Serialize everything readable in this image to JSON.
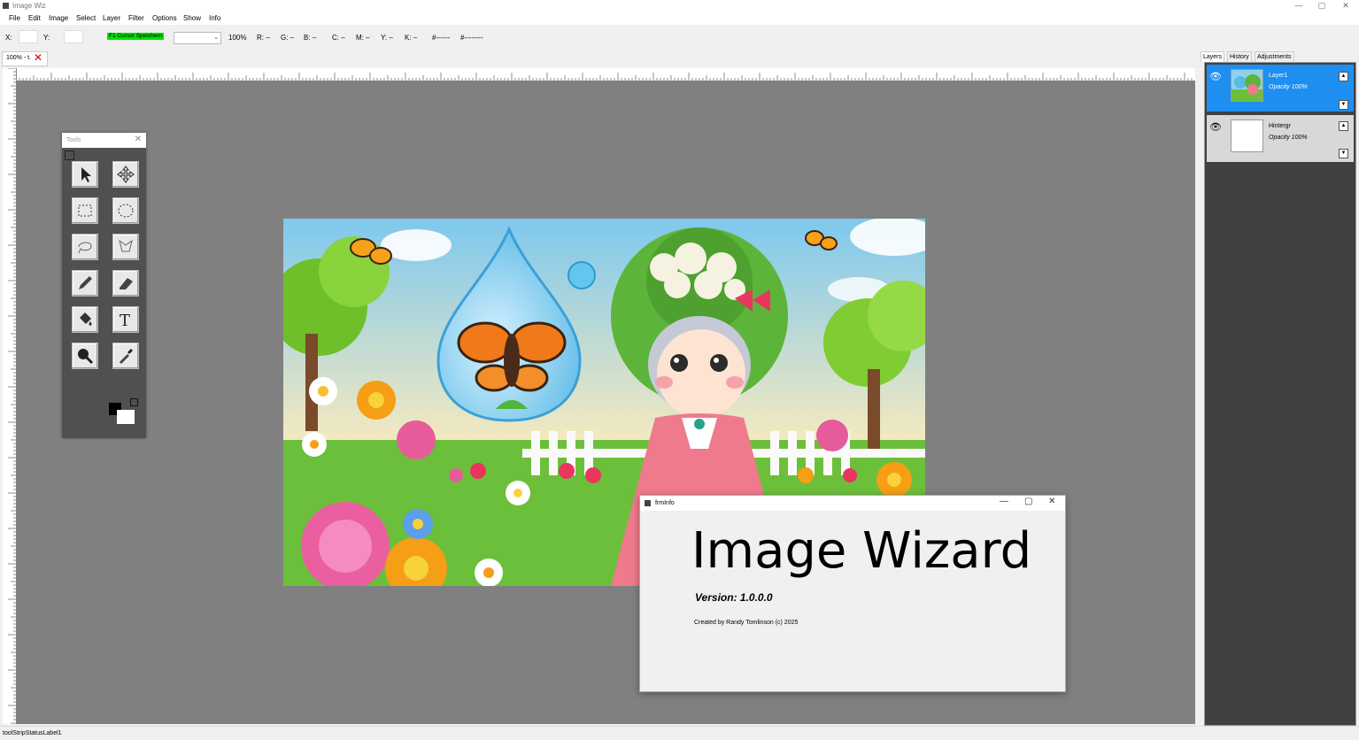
{
  "window": {
    "title": "Image Wiz",
    "controls": [
      "—",
      "▢",
      "✕"
    ]
  },
  "menu": [
    "File",
    "Edit",
    "Image",
    "Select",
    "Layer",
    "Filter",
    "Options",
    "Show",
    "Info"
  ],
  "toolbar": {
    "x_label": "X:",
    "y_label": "Y:",
    "cursor_button": "F1 Cursor Speichern",
    "zoom": "100%",
    "r": "R:  –",
    "g": "G:  –",
    "b": "B:  –",
    "c": "C:  –",
    "m": "M:  –",
    "y": "Y:  –",
    "k": "K:  –",
    "hex1": "#------",
    "hex2": "#--------"
  },
  "document_tab": {
    "label": "100% - t.",
    "close": "✕"
  },
  "tools": {
    "title": "Tools",
    "close": "✕",
    "items": [
      "pointer",
      "move",
      "rect-select",
      "ellipse-select",
      "lasso",
      "poly-lasso",
      "pencil",
      "eraser",
      "fill",
      "text",
      "zoom",
      "eyedropper"
    ]
  },
  "panel": {
    "tabs": [
      "Layers",
      "History",
      "Adjustments"
    ],
    "layers": [
      {
        "name": "Layer1",
        "opacity": "Opacity 100%",
        "selected": true
      },
      {
        "name": "Hintergr",
        "opacity": "Opacity 100%",
        "selected": false
      }
    ]
  },
  "dialog": {
    "title": "frmInfo",
    "heading": "Image Wizard",
    "version": "Version: 1.0.0.0",
    "credit": "Created by Randy Tomlinson (c) 2025"
  },
  "status": "toolStripStatusLabel1",
  "colors": {
    "accent": "#1e8ff0",
    "canvas_bg": "#808080",
    "tools_bg": "#505050",
    "layers_bg": "#404040",
    "cursor_btn": "#00e000"
  }
}
